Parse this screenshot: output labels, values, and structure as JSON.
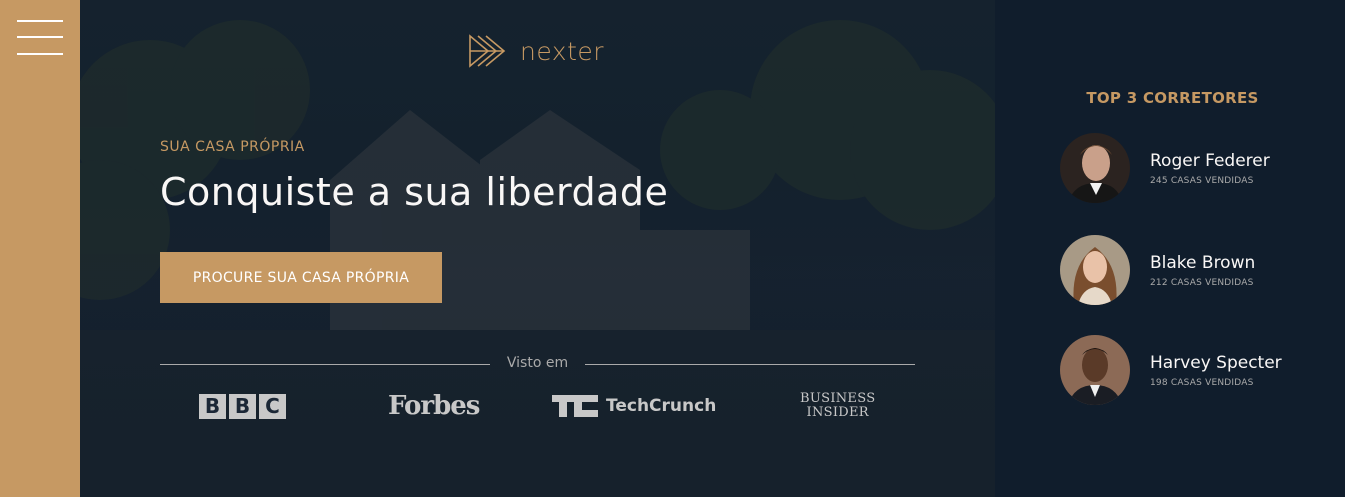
{
  "brand": {
    "name": "nexter",
    "accent": "#c69963",
    "dark": "#101d2c"
  },
  "hero": {
    "eyebrow": "SUA CASA PRÓPRIA",
    "headline": "Conquiste a sua liberdade",
    "cta_label": "PROCURE SUA CASA PRÓPRIA",
    "seen_on_label": "Visto em",
    "press": {
      "bbc": [
        "B",
        "B",
        "C"
      ],
      "forbes": "Forbes",
      "techcrunch": "TechCrunch",
      "business_insider": [
        "BUSINESS",
        "INSIDER"
      ]
    }
  },
  "realtors": {
    "title": "TOP 3 CORRETORES",
    "items": [
      {
        "name": "Roger Federer",
        "sold": "245 CASAS VENDIDAS"
      },
      {
        "name": "Blake Brown",
        "sold": "212 CASAS VENDIDAS"
      },
      {
        "name": "Harvey Specter",
        "sold": "198 CASAS VENDIDAS"
      }
    ]
  },
  "icons": {
    "menu": "hamburger-icon",
    "logo": "play-chevrons-icon"
  }
}
